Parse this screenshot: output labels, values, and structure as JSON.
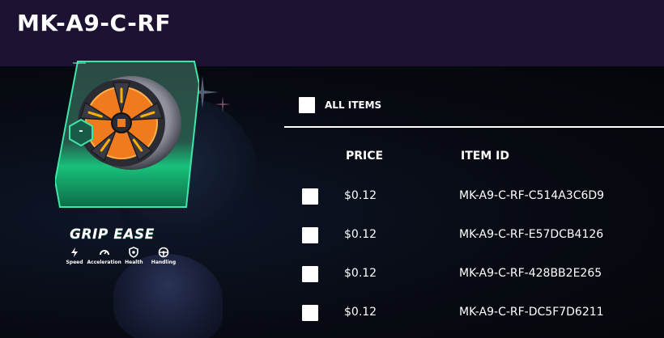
{
  "header": {
    "title": "MK-A9-C-RF"
  },
  "card": {
    "name": "GRIP EASE",
    "badge": "-",
    "stats": [
      {
        "label": "Speed",
        "icon": "lightning-icon"
      },
      {
        "label": "Acceleration",
        "icon": "speedometer-icon"
      },
      {
        "label": "Health",
        "icon": "shield-icon"
      },
      {
        "label": "Handling",
        "icon": "steering-wheel-icon"
      }
    ]
  },
  "table": {
    "select_all_label": "ALL ITEMS",
    "columns": {
      "price": "PRICE",
      "item_id": "ITEM ID"
    },
    "rows": [
      {
        "price": "$0.12",
        "item_id": "MK-A9-C-RF-C514A3C6D9",
        "checked": false
      },
      {
        "price": "$0.12",
        "item_id": "MK-A9-C-RF-E57DCB4126",
        "checked": false
      },
      {
        "price": "$0.12",
        "item_id": "MK-A9-C-RF-428BB2E265",
        "checked": false
      },
      {
        "price": "$0.12",
        "item_id": "MK-A9-C-RF-DC5F7D6211",
        "checked": false
      }
    ]
  },
  "colors": {
    "header_bg": "#1e1233",
    "page_bg": "#05070c",
    "card_green": "#17c27a",
    "wheel_orange": "#f07a1e"
  }
}
